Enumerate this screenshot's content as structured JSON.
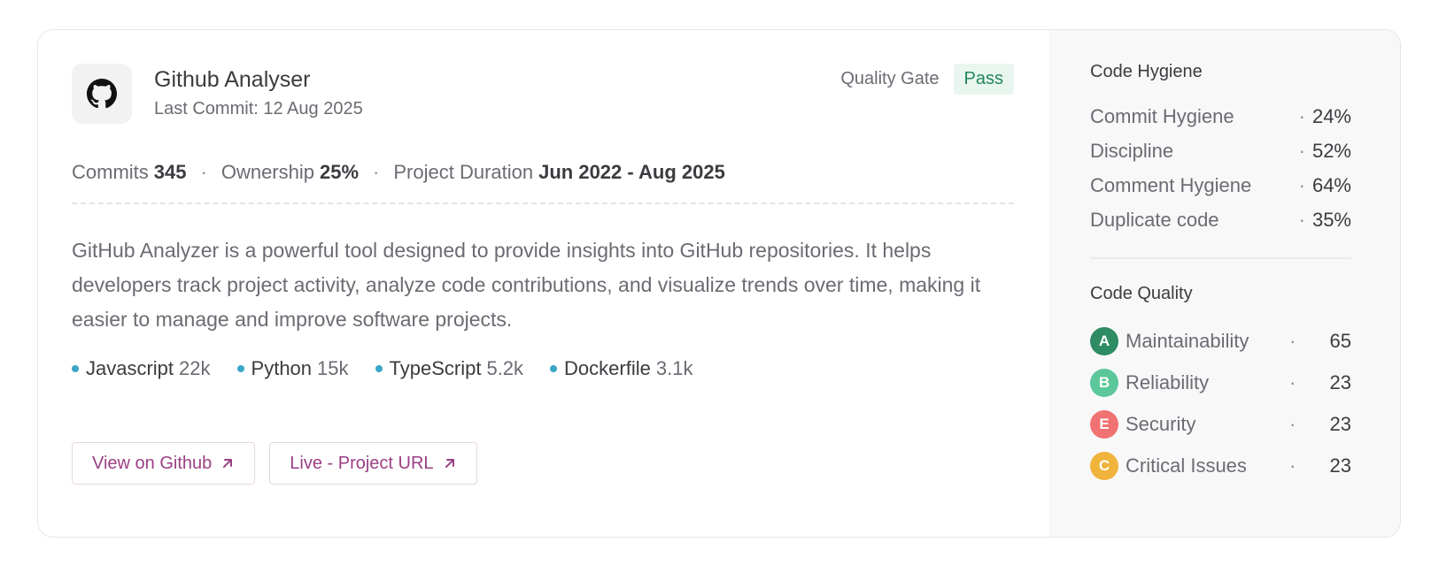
{
  "project": {
    "title": "Github Analyser",
    "last_commit": "Last Commit: 12 Aug 2025",
    "quality_gate_label": "Quality Gate",
    "quality_gate_status": "Pass"
  },
  "stats": {
    "commits_label": "Commits",
    "commits_value": "345",
    "ownership_label": "Ownership",
    "ownership_value": "25%",
    "duration_label": "Project Duration",
    "duration_value": "Jun 2022 - Aug 2025",
    "separator": "·"
  },
  "description": "GitHub Analyzer is a powerful tool designed to provide insights into GitHub repositories. It helps developers track project activity, analyze code contributions, and visualize trends over time, making it easier to manage and improve software projects.",
  "languages": [
    {
      "name": "Javascript",
      "value": "22k"
    },
    {
      "name": "Python",
      "value": "15k"
    },
    {
      "name": "TypeScript",
      "value": "5.2k"
    },
    {
      "name": "Dockerfile",
      "value": "3.1k"
    }
  ],
  "buttons": {
    "github": "View on Github",
    "live": "Live - Project URL"
  },
  "hygiene": {
    "title": "Code Hygiene",
    "items": [
      {
        "label": "Commit Hygiene",
        "value": "24%"
      },
      {
        "label": "Discipline",
        "value": "52%"
      },
      {
        "label": "Comment Hygiene",
        "value": "64%"
      },
      {
        "label": "Duplicate code",
        "value": "35%"
      }
    ]
  },
  "quality": {
    "title": "Code Quality",
    "items": [
      {
        "grade": "A",
        "label": "Maintainability",
        "value": "65",
        "color": "#2e8b63"
      },
      {
        "grade": "B",
        "label": "Reliability",
        "value": "23",
        "color": "#5cc79a"
      },
      {
        "grade": "E",
        "label": "Security",
        "value": "23",
        "color": "#f07272"
      },
      {
        "grade": "C",
        "label": "Critical Issues",
        "value": "23",
        "color": "#f0b33c"
      }
    ]
  },
  "colors": {
    "accent": "#9b3f84",
    "pass_text": "#22885a",
    "pass_bg": "#e9f6ef",
    "lang_dot": "#3aa6c8"
  },
  "icons": {
    "logo": "github-icon",
    "external": "arrow-up-right-icon"
  }
}
